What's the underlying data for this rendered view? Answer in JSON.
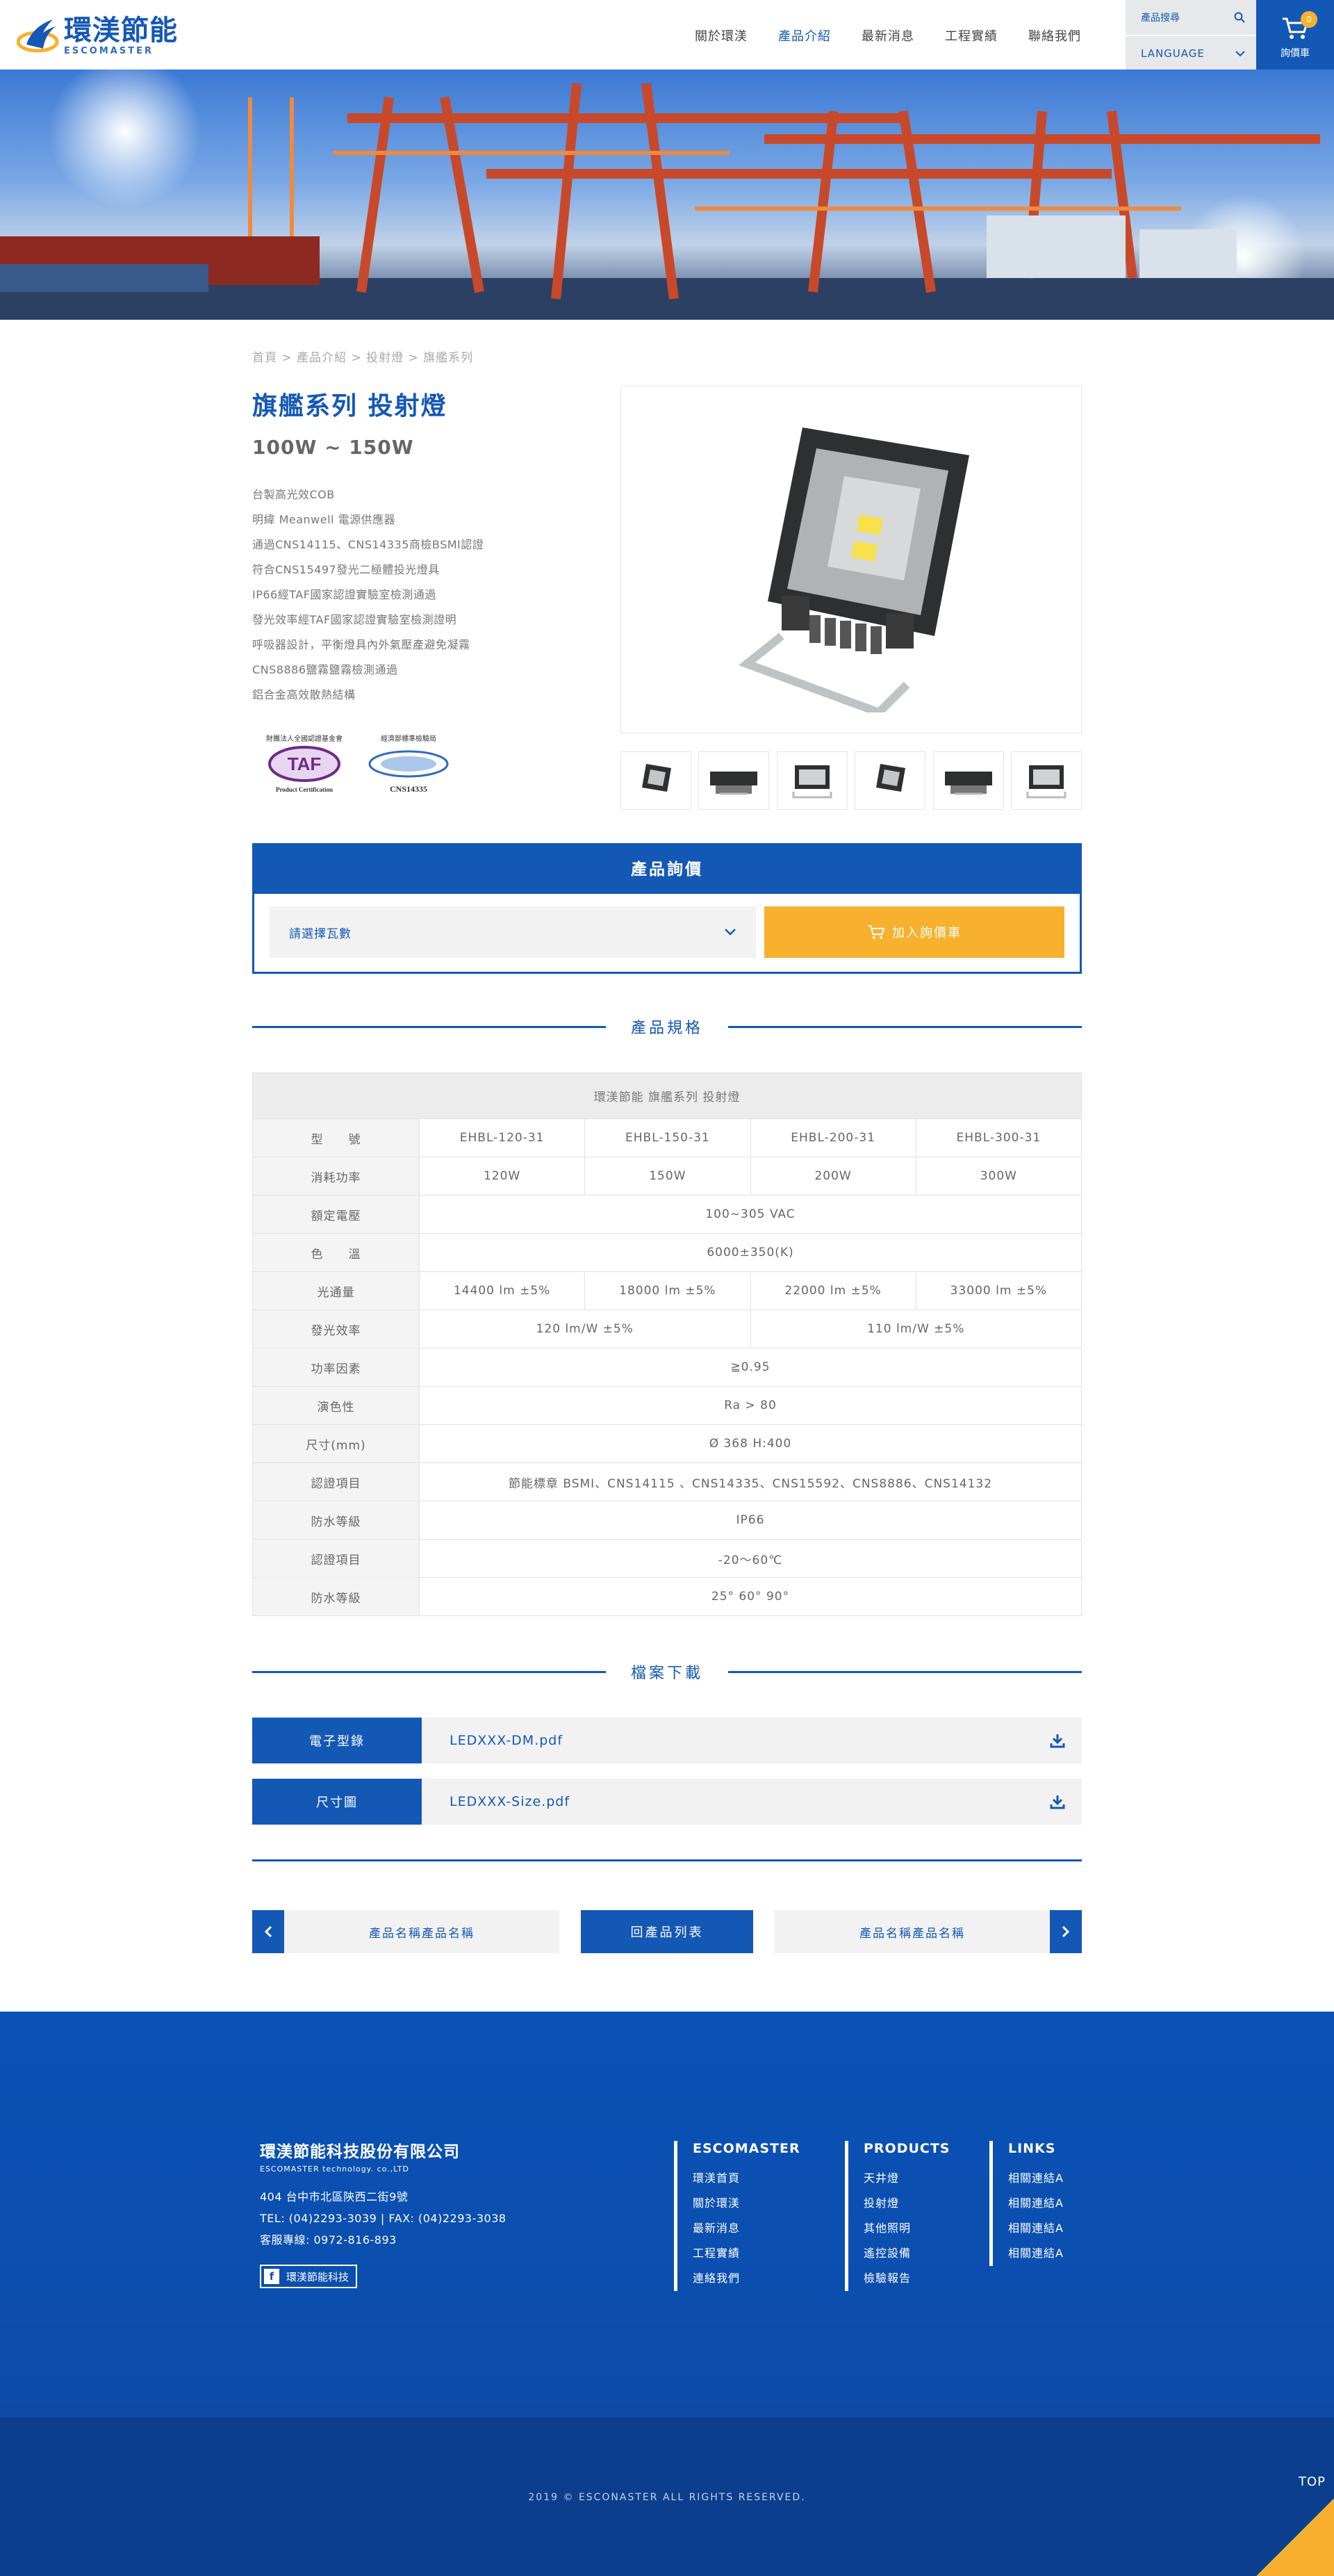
{
  "header": {
    "logo_cn": "環渼節能",
    "logo_en": "ESCOMASTER",
    "nav": [
      "關於環渼",
      "產品介紹",
      "最新消息",
      "工程實績",
      "聯絡我們"
    ],
    "search_placeholder": "產品搜尋",
    "language_label": "LANGUAGE",
    "cart_count": "0",
    "cart_label": "詢價車"
  },
  "breadcrumb": "首頁 > 產品介紹 > 投射燈 > 旗艦系列",
  "product": {
    "title": "旗艦系列 投射燈",
    "subtitle": "100W ~ 150W",
    "features": [
      "台製高光效COB",
      "明緯 Meanwell 電源供應器",
      "通過CNS14115、CNS14335商檢BSMI認證",
      "符合CNS15497發光二極體投光燈具",
      "IP66經TAF國家認證實驗室檢測通過",
      "發光效率經TAF國家認證實驗室檢測證明",
      "呼吸器設計，平衡燈具內外氣壓產避免凝霧",
      "CNS8886鹽霧鹽霧檢測通過",
      "鋁合金高效散熱結構"
    ],
    "cert_taf_caption": "財團法人全國認證基金會",
    "cert_taf_mark": "TAF",
    "cert_taf_sub": "Product Certification",
    "cert_cns_caption": "經濟部標準檢驗局",
    "cert_cns_mark": "CNS14335"
  },
  "inquiry": {
    "title": "產品詢價",
    "select_placeholder": "請選擇瓦數",
    "add_button": "加入詢價車"
  },
  "spec": {
    "section_title": "產品規格",
    "caption": "環渼節能 旗艦系列 投射燈",
    "models_label": "型　　號",
    "models": [
      "EHBL-120-31",
      "EHBL-150-31",
      "EHBL-200-31",
      "EHBL-300-31"
    ],
    "power_label": "消耗功率",
    "power": [
      "120W",
      "150W",
      "200W",
      "300W"
    ],
    "voltage_label": "額定電壓",
    "voltage": "100~305 VAC",
    "cct_label": "色　　溫",
    "cct": "6000±350(K)",
    "flux_label": "光通量",
    "flux": [
      "14400 lm ±5%",
      "18000 lm ±5%",
      "22000 lm ±5%",
      "33000 lm ±5%"
    ],
    "efficacy_label": "發光效率",
    "efficacy": [
      "120 lm/W ±5%",
      "110 lm/W ±5%"
    ],
    "pf_label": "功率因素",
    "pf": "≧0.95",
    "cri_label": "演色性",
    "cri": "Ra > 80",
    "size_label": "尺寸(mm)",
    "size": "Ø 368  H:400",
    "cert_label": "認證項目",
    "cert": "節能標章  BSMI、CNS14115 、CNS14335、CNS15592、CNS8886、CNS14132",
    "ip_label": "防水等級",
    "ip": "IP66",
    "temp_label": "認證項目",
    "temp": "-20～60℃",
    "angle_label": "防水等級",
    "angle": "25° 60° 90°"
  },
  "downloads": {
    "section_title": "檔案下載",
    "items": [
      {
        "label": "電子型錄",
        "file": "LEDXXX-DM.pdf"
      },
      {
        "label": "尺寸圖",
        "file": "LEDXXX-Size.pdf"
      }
    ]
  },
  "pager": {
    "prev": "產品名稱產品名稱",
    "back": "回產品列表",
    "next": "產品名稱產品名稱"
  },
  "footer": {
    "company_cn": "環渼節能科技股份有限公司",
    "company_en": "ESCOMASTER technology. co.,LTD",
    "address": "404 台中市北區陝西二街9號",
    "tel": "TEL: (04)2293-3039   |  FAX: (04)2293-3038",
    "hotline": "客服專線: 0972-816-893",
    "facebook": "環渼節能科技",
    "col1_title": "ESCOMASTER",
    "col1": [
      "環渼首頁",
      "關於環渼",
      "最新消息",
      "工程實績",
      "連絡我們"
    ],
    "col2_title": "PRODUCTS",
    "col2": [
      "天井燈",
      "投射燈",
      "其他照明",
      "遙控設備",
      "檢驗報告"
    ],
    "col3_title": "LINKS",
    "col3": [
      "相關連結A",
      "相關連結A",
      "相關連結A",
      "相關連結A"
    ],
    "copyright": "2019 © ESCONASTER ALL RIGHTS RESERVED.",
    "top": "TOP"
  },
  "colors": {
    "brand": "#1458b6",
    "accent": "#f7b12f"
  }
}
